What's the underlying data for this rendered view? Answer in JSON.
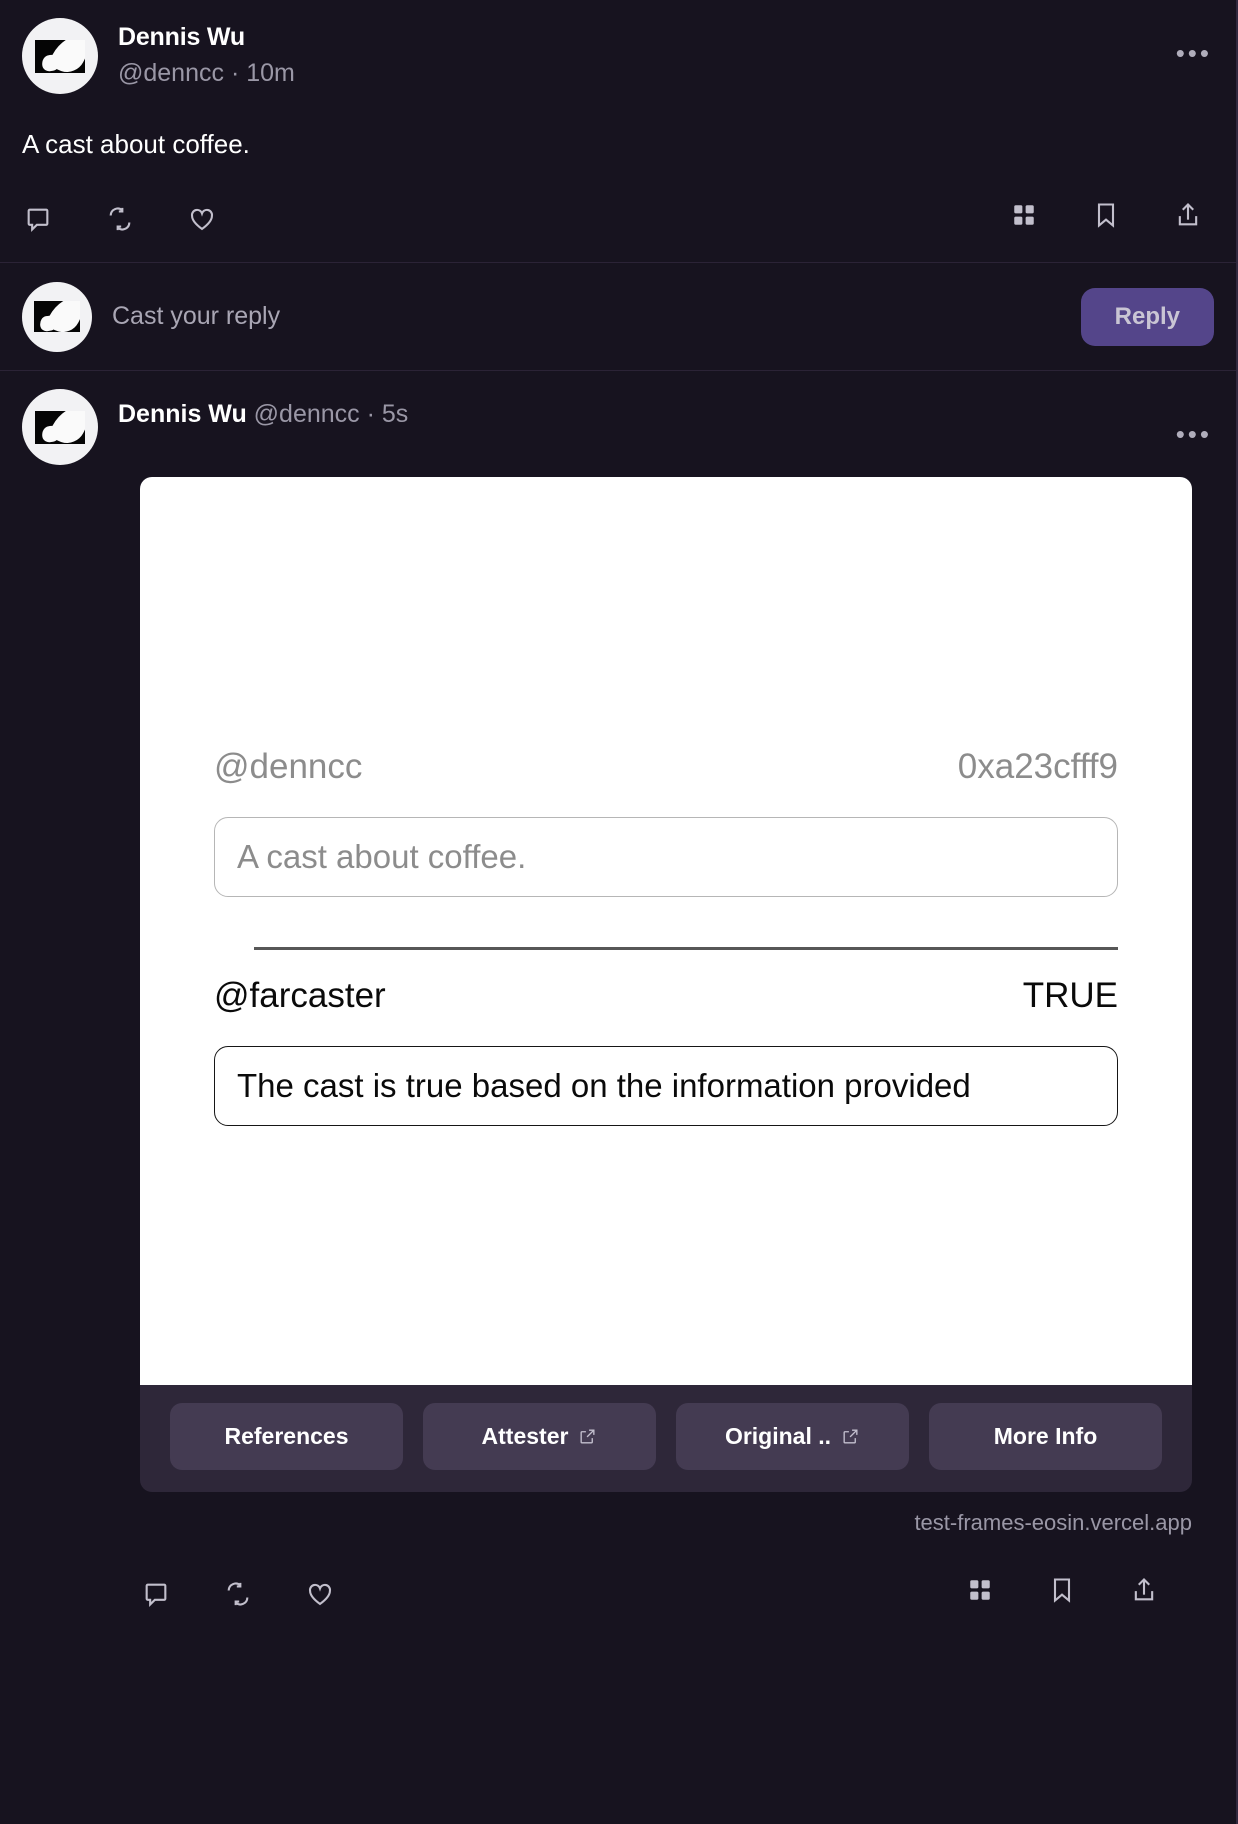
{
  "theme": {
    "background": "#17131f",
    "accent": "#54458a",
    "divider": "#2b2336",
    "frame_bg": "#2e2739",
    "frame_button": "#443b52",
    "muted_text": "#9a97a6"
  },
  "top_cast": {
    "display_name": "Dennis Wu",
    "handle_line": "@denncc · 10m",
    "body": "A cast about coffee.",
    "more_label": "•••",
    "actions": {
      "comment": "comment-icon",
      "recast": "recast-icon",
      "like": "like-icon",
      "grid": "grid-icon",
      "bookmark": "bookmark-icon",
      "share": "share-icon"
    }
  },
  "composer": {
    "placeholder": "Cast your reply",
    "reply_label": "Reply"
  },
  "reply_cast": {
    "display_name": "Dennis Wu",
    "handle": "@denncc · 5s",
    "more_label": "•••",
    "frame": {
      "cast_author": "@denncc",
      "cast_hash": "0xa23cfff9",
      "cast_text": "A cast about coffee.",
      "attester_handle": "@farcaster",
      "verdict": "TRUE",
      "verdict_explanation": "The cast is true based on the information provided",
      "buttons": [
        {
          "label": "References",
          "external": false
        },
        {
          "label": "Attester",
          "external": true
        },
        {
          "label": "Original ..",
          "external": true
        },
        {
          "label": "More Info",
          "external": false
        }
      ],
      "domain": "test-frames-eosin.vercel.app"
    }
  }
}
